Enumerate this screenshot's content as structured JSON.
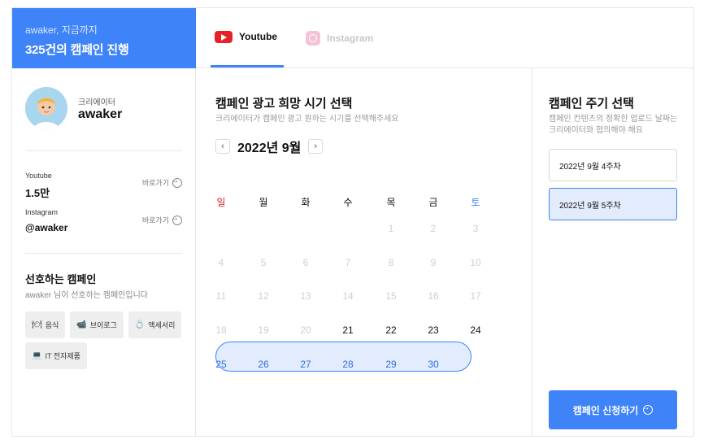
{
  "header": {
    "subtitle": "awaker, 지금까지",
    "title": "325건의 캠페인 진행"
  },
  "tabs": [
    {
      "label": "Youtube",
      "active": true,
      "icon": "youtube-icon"
    },
    {
      "label": "Instagram",
      "active": false,
      "icon": "instagram-icon"
    }
  ],
  "profile": {
    "role": "크리에이터",
    "name": "awaker"
  },
  "stats": [
    {
      "label": "Youtube",
      "value": "1.5만",
      "shortcut": "바로가기"
    },
    {
      "label": "Instagram",
      "value": "@awaker",
      "shortcut": "바로가기"
    }
  ],
  "preferences": {
    "title": "선호하는 캠페인",
    "subtitle": "awaker 님이 선호하는 캠페인입니다",
    "chips": [
      {
        "icon": "utensils-icon",
        "glyph": "🍽",
        "label": "음식"
      },
      {
        "icon": "video-camera-icon",
        "glyph": "📹",
        "label": "브이로그"
      },
      {
        "icon": "ring-icon",
        "glyph": "💍",
        "label": "액세서리"
      },
      {
        "icon": "laptop-icon",
        "glyph": "💻",
        "label": "IT 전자제품"
      }
    ]
  },
  "calendar_section": {
    "title": "캠페인 광고 희망 시기 선택",
    "subtitle": "크리에이터가 캠페인 광고 원하는 시기를 선택해주세요",
    "month": "2022년 9월",
    "prev": "‹",
    "next": "›",
    "weekdays": [
      "일",
      "월",
      "화",
      "수",
      "목",
      "금",
      "토"
    ],
    "weeks": [
      [
        null,
        null,
        null,
        null,
        "1",
        "2",
        "3"
      ],
      [
        "4",
        "5",
        "6",
        "7",
        "8",
        "9",
        "10"
      ],
      [
        "11",
        "12",
        "13",
        "14",
        "15",
        "16",
        "17"
      ],
      [
        "18",
        "19",
        "20",
        "21",
        "22",
        "23",
        "24"
      ],
      [
        "25",
        "26",
        "27",
        "28",
        "29",
        "30",
        null
      ]
    ],
    "first_enabled_day": 21,
    "selected_week_index": 4
  },
  "cycle_section": {
    "title": "캠페인 주기 선택",
    "subtitle": "캠페인 컨텐츠의 정확한 업로드 날짜는 크리에이터와 협의해야 해요",
    "options": [
      {
        "label": "2022년 9월 4주차",
        "selected": false
      },
      {
        "label": "2022년 9월 5주차",
        "selected": true
      }
    ],
    "apply_label": "캠페인 신청하기"
  },
  "colors": {
    "accent": "#3f83f8",
    "selected_bg": "#e3ecfd",
    "sunday": "#e5212a",
    "saturday": "#3f83f8",
    "disabled": "#cfcfcf"
  }
}
